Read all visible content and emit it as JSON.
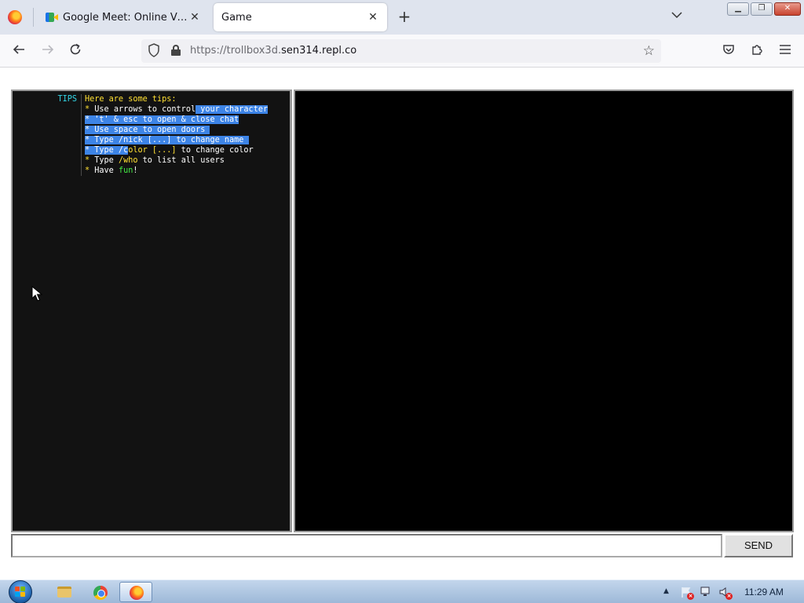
{
  "browser": {
    "tabs": [
      {
        "title": "Google Meet: Online Video Meeting",
        "active": false,
        "icon": "google-meet-icon"
      },
      {
        "title": "Game",
        "active": true
      }
    ],
    "url": {
      "prefix": "https://trollbox3d.",
      "host": "sen314.repl.co"
    }
  },
  "chat": {
    "message": {
      "nick": "TIPS",
      "lines": [
        [
          {
            "text": "Here are some tips:",
            "color": "yellow"
          }
        ],
        [
          {
            "text": "* ",
            "color": "yellow"
          },
          {
            "text": "Use arrows to control",
            "color": "white"
          },
          {
            "text": " your character",
            "color": "white",
            "selected": true
          }
        ],
        [
          {
            "text": "* 't' & esc to open & close chat",
            "color": "white",
            "selected": true
          }
        ],
        [
          {
            "text": "* Use space to open doors ",
            "color": "white",
            "selected": true
          }
        ],
        [
          {
            "text": "* Type /nick [...] to change name ",
            "color": "white",
            "selected": true
          }
        ],
        [
          {
            "text": "* Type /c",
            "color": "white",
            "selected": true
          },
          {
            "text": "olor [...]",
            "color": "yellow"
          },
          {
            "text": " to change color",
            "color": "white"
          }
        ],
        [
          {
            "text": "* ",
            "color": "yellow"
          },
          {
            "text": "Type ",
            "color": "white"
          },
          {
            "text": "/who",
            "color": "yellow"
          },
          {
            "text": " to list all users",
            "color": "white"
          }
        ],
        [
          {
            "text": "* ",
            "color": "yellow"
          },
          {
            "text": "Have ",
            "color": "white"
          },
          {
            "text": "fun",
            "color": "green"
          },
          {
            "text": "!",
            "color": "white"
          }
        ]
      ]
    },
    "input": {
      "value": "",
      "placeholder": ""
    },
    "send_label": "SEND"
  },
  "taskbar": {
    "apps": [
      {
        "name": "file-explorer",
        "active": false
      },
      {
        "name": "chrome",
        "active": false
      },
      {
        "name": "firefox",
        "active": true
      }
    ],
    "clock": "11:29 AM"
  }
}
